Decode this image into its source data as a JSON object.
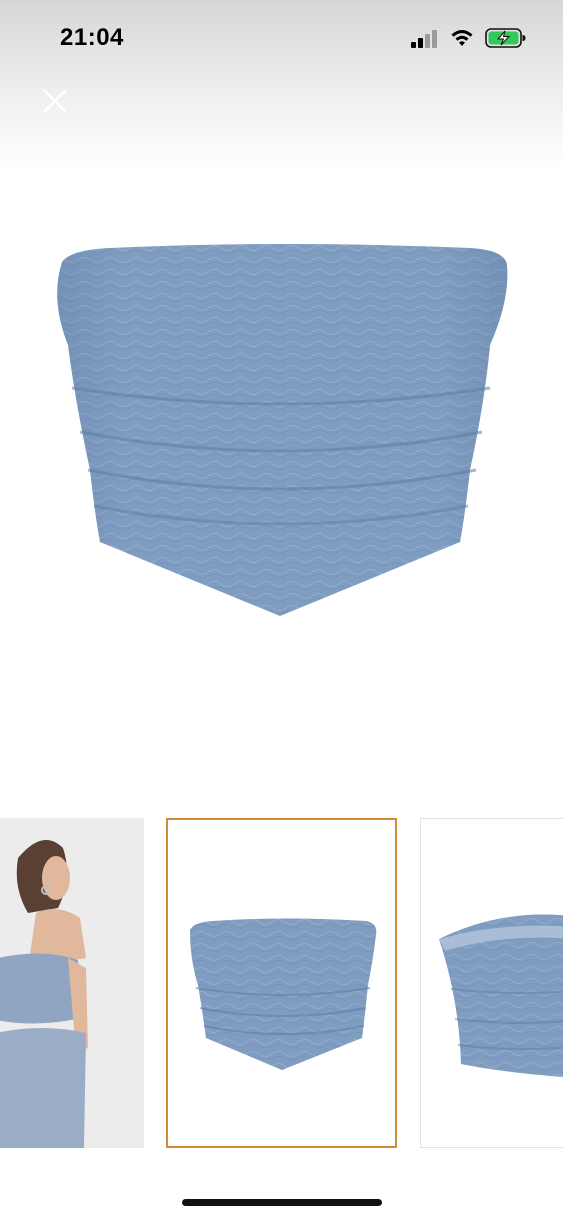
{
  "status_bar": {
    "time": "21:04",
    "icons": [
      "cellular-signal-icon",
      "wifi-icon",
      "battery-charging-icon"
    ],
    "battery_color": "#34c759"
  },
  "viewer": {
    "close_icon": "close-icon",
    "selected_thumbnail": 2,
    "accent_color": "#d08b38",
    "product_color": "#7f9cc1"
  },
  "thumbnails": [
    {
      "name": "model-back-view"
    },
    {
      "name": "front-view"
    },
    {
      "name": "side-view"
    }
  ]
}
